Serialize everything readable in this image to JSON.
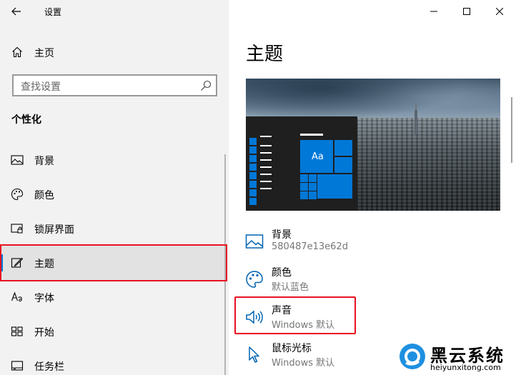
{
  "window": {
    "app_title": "设置",
    "controls": [
      "minimize",
      "maximize",
      "close"
    ]
  },
  "nav": {
    "home_label": "主页",
    "search_placeholder": "查找设置",
    "section_heading": "个性化",
    "items": [
      {
        "label": "背景",
        "icon": "picture-icon"
      },
      {
        "label": "颜色",
        "icon": "palette-icon"
      },
      {
        "label": "锁屏界面",
        "icon": "lock-screen-icon"
      },
      {
        "label": "主题",
        "icon": "theme-icon",
        "selected": true
      },
      {
        "label": "字体",
        "icon": "font-icon"
      },
      {
        "label": "开始",
        "icon": "start-icon"
      },
      {
        "label": "任务栏",
        "icon": "taskbar-icon"
      }
    ]
  },
  "main": {
    "page_title": "主题",
    "preview_tile_label": "Aa",
    "settings": [
      {
        "title": "背景",
        "subtitle": "580487e13e62d",
        "icon": "picture-icon"
      },
      {
        "title": "颜色",
        "subtitle": "默认蓝色",
        "icon": "palette-icon"
      },
      {
        "title": "声音",
        "subtitle": "Windows 默认",
        "icon": "speaker-icon"
      },
      {
        "title": "鼠标光标",
        "subtitle": "Windows 默认",
        "icon": "cursor-icon"
      }
    ]
  },
  "watermark": {
    "brand": "黑云系统",
    "url": "heiyunxitong.com"
  },
  "colors": {
    "accent": "#0078d7",
    "highlight_border": "#e81123",
    "nav_background": "#f2f2f2",
    "selected_background": "#e2e2e2"
  }
}
